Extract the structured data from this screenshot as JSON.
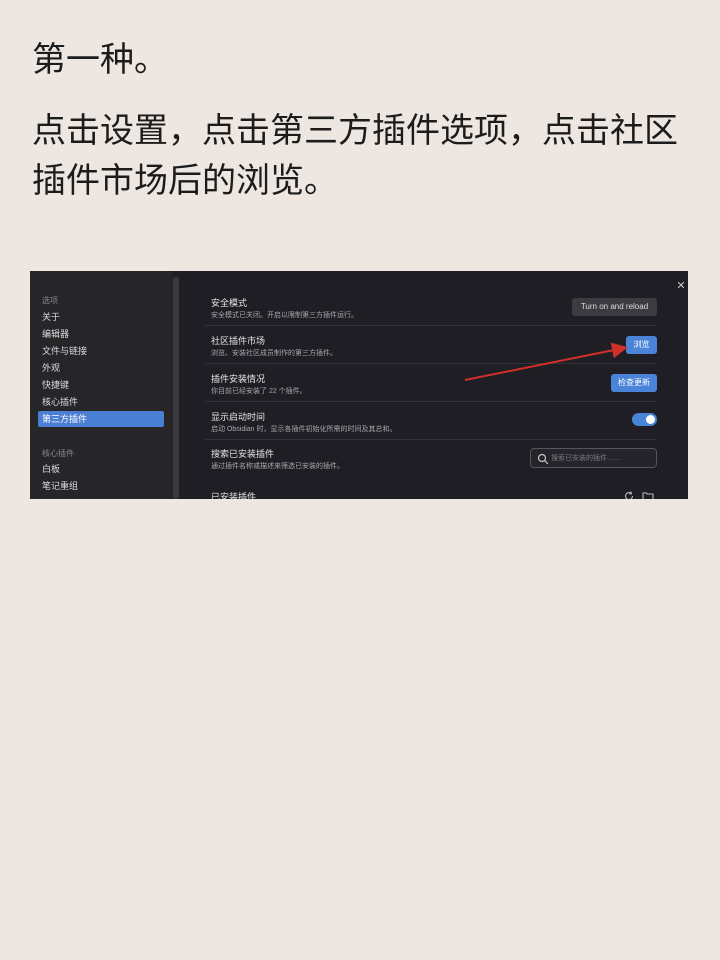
{
  "heading": "第一种。",
  "instruction": "点击设置，点击第三方插件选项，点击社区插件市场后的浏览。",
  "colors": {
    "page_bg": "#ede6e1",
    "accent": "#4a84d8",
    "arrow": "#d0302a"
  },
  "settings": {
    "sidebar": {
      "group_options": "选项",
      "items": [
        "关于",
        "编辑器",
        "文件与链接",
        "外观",
        "快捷键",
        "核心插件",
        "第三方插件"
      ],
      "active_item": "第三方插件",
      "group_core": "核心插件",
      "core_items": [
        "白板",
        "笔记重组"
      ]
    },
    "rows": {
      "safe_mode": {
        "title": "安全模式",
        "desc": "安全模式已关闭。开启以限制第三方插件运行。",
        "button": "Turn on and reload"
      },
      "community": {
        "title": "社区插件市场",
        "desc": "浏览、安装社区成员制作的第三方插件。",
        "button": "浏览"
      },
      "install_status": {
        "title": "插件安装情况",
        "desc": "你目前已经安装了 22 个插件。",
        "button": "检查更新"
      },
      "startup_time": {
        "title": "显示启动时间",
        "desc": "启动 Obsidian 时，显示各插件初始化所需的时间及其总和。",
        "toggle_on": true
      },
      "search_installed": {
        "title": "搜索已安装插件",
        "desc": "通过插件名称或描述来筛选已安装的插件。",
        "placeholder": "搜索已安装的插件……"
      },
      "installed": {
        "title": "已安装插件"
      }
    },
    "icons": [
      "close-icon",
      "search-icon",
      "refresh-icon",
      "folder-icon"
    ]
  }
}
